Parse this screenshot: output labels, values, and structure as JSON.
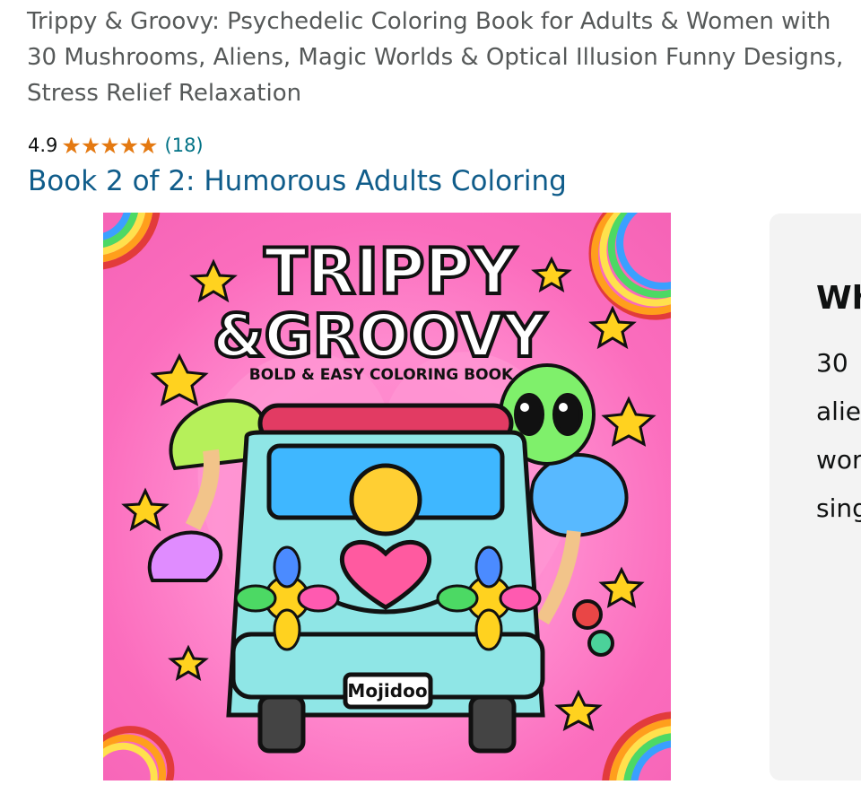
{
  "product": {
    "title": "Trippy & Groovy: Psychedelic Coloring Book for Adults & Women with 30 Mushrooms, Aliens, Magic Worlds & Optical Illusion Funny Designs, Stress Relief Relaxation",
    "rating_value": "4.9",
    "star_count": 5,
    "rating_count": "(18)",
    "series_link": "Book 2 of 2: Humorous Adults Coloring"
  },
  "cover": {
    "line1": "TRIPPY",
    "line2": "&GROOVY",
    "subtitle": "BOLD & EASY COLORING BOOK",
    "plate": "Mojidoo",
    "colors": {
      "background": "#f36bbd",
      "van": "#8fe6e6",
      "title_fill": "#ffffff"
    }
  },
  "side_panel": {
    "heading": "Wh",
    "lines": [
      "30",
      "alie",
      "wor",
      "sing"
    ]
  }
}
